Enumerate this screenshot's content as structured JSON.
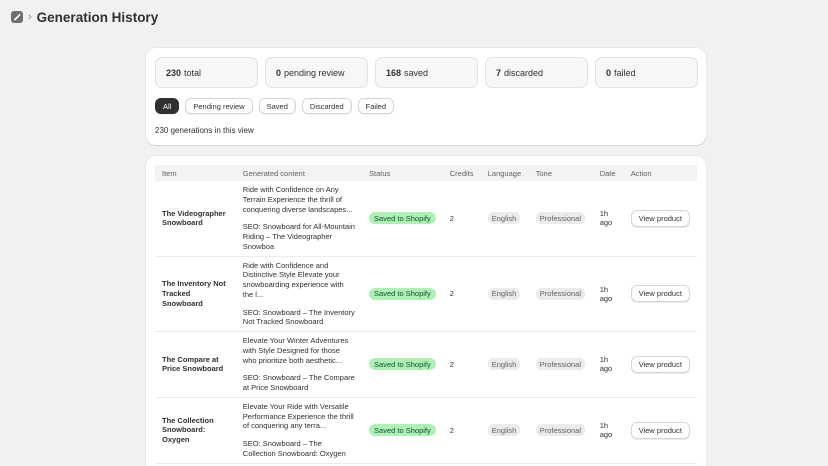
{
  "header": {
    "title": "Generation History"
  },
  "stats": [
    {
      "value": "230",
      "label": "total"
    },
    {
      "value": "0",
      "label": "pending review"
    },
    {
      "value": "168",
      "label": "saved"
    },
    {
      "value": "7",
      "label": "discarded"
    },
    {
      "value": "0",
      "label": "failed"
    }
  ],
  "filters": [
    "All",
    "Pending review",
    "Saved",
    "Discarded",
    "Failed"
  ],
  "active_filter": "All",
  "view_count": "230 generations in this view",
  "table": {
    "columns": [
      "Item",
      "Generated content",
      "Status",
      "Credits",
      "Language",
      "Tone",
      "Date",
      "Action"
    ],
    "rows": [
      {
        "item": "The Videographer Snowboard",
        "content": "Ride with Confidence on Any Terrain Experience the thrill of conquering diverse landscapes...",
        "seo": "SEO: Snowboard for All-Mountain Riding – The Videographer Snowboa",
        "status": "Saved to Shopify",
        "credits": "2",
        "language": "English",
        "tone": "Professional",
        "date": "1h ago",
        "action": "View product"
      },
      {
        "item": "The Inventory Not Tracked Snowboard",
        "content": "Ride with Confidence and Distinctive Style Elevate your snowboarding experience with the l...",
        "seo": "SEO: Snowboard – The Inventory Not Tracked Snowboard",
        "status": "Saved to Shopify",
        "credits": "2",
        "language": "English",
        "tone": "Professional",
        "date": "1h ago",
        "action": "View product"
      },
      {
        "item": "The Compare at Price Snowboard",
        "content": "Elevate Your Winter Adventures with Style Designed for those who prioritize both aesthetic...",
        "seo": "SEO: Snowboard – The Compare at Price Snowboard",
        "status": "Saved to Shopify",
        "credits": "2",
        "language": "English",
        "tone": "Professional",
        "date": "1h ago",
        "action": "View product"
      },
      {
        "item": "The Collection Snowboard: Oxygen",
        "content": "Elevate Your Ride with Versatile Performance Experience the thrill of conquering any terra...",
        "seo": "SEO: Snowboard – The Collection Snowboard: Oxygen",
        "status": "Saved to Shopify",
        "credits": "2",
        "language": "English",
        "tone": "Professional",
        "date": "1h ago",
        "action": "View product"
      }
    ]
  }
}
